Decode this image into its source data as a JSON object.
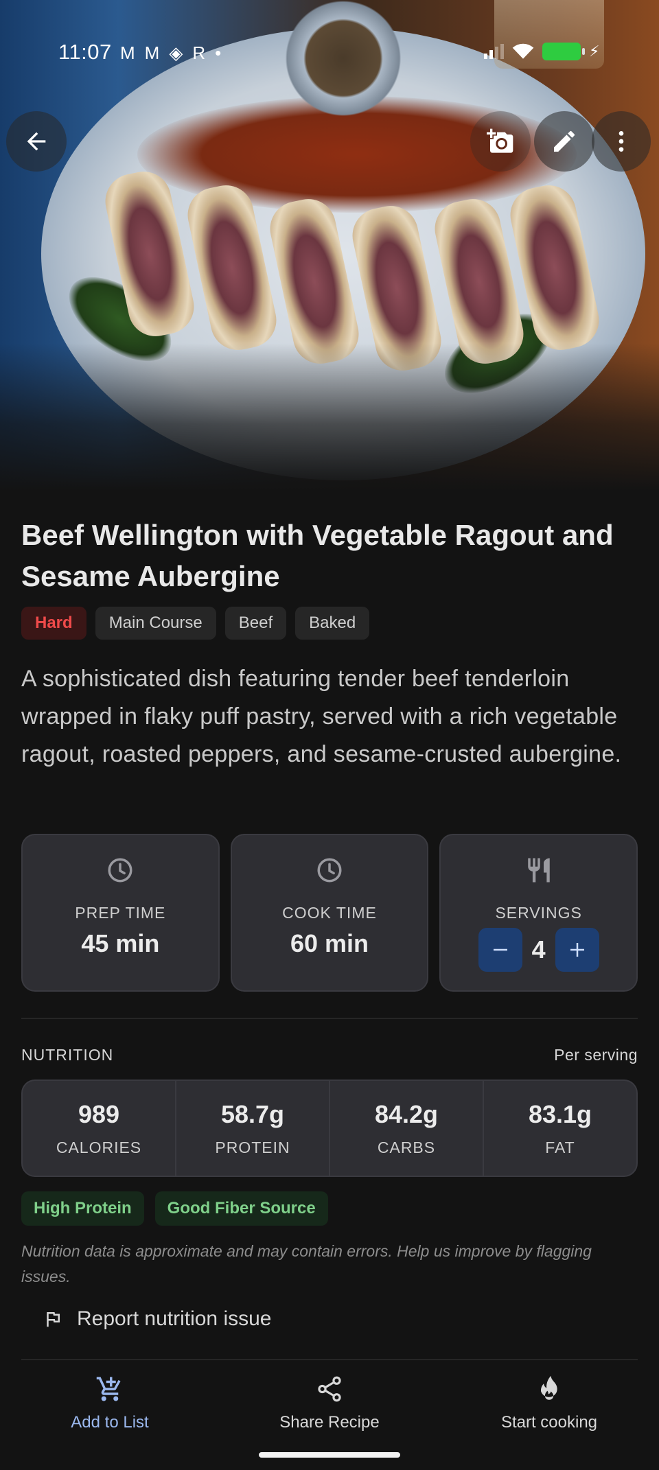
{
  "status_bar": {
    "time": "11:07",
    "notification_icons": [
      "gmail-icon",
      "gmail-icon",
      "app-icon",
      "r-icon",
      "dot-icon"
    ]
  },
  "top_actions": {
    "back": "back-arrow-icon",
    "add_photo": "add-photo-icon",
    "edit": "edit-pencil-icon",
    "more": "more-vert-icon"
  },
  "recipe": {
    "title": "Beef Wellington with Vegetable Ragout and Sesame Aubergine",
    "tags": [
      {
        "label": "Hard"
      },
      {
        "label": "Main Course"
      },
      {
        "label": "Beef"
      },
      {
        "label": "Baked"
      }
    ],
    "description": "A sophisticated dish featuring tender beef tenderloin wrapped in flaky puff pastry, served with a rich vegetable ragout, roasted peppers, and sesame-crusted aubergine."
  },
  "stats": {
    "prep": {
      "label": "PREP TIME",
      "value": "45 min"
    },
    "cook": {
      "label": "COOK TIME",
      "value": "60 min"
    },
    "servings": {
      "label": "SERVINGS",
      "value": "4"
    }
  },
  "nutrition": {
    "heading": "NUTRITION",
    "per": "Per serving",
    "items": [
      {
        "value": "989",
        "label": "CALORIES"
      },
      {
        "value": "58.7g",
        "label": "PROTEIN"
      },
      {
        "value": "84.2g",
        "label": "CARBS"
      },
      {
        "value": "83.1g",
        "label": "FAT"
      }
    ],
    "badges": [
      {
        "label": "High Protein"
      },
      {
        "label": "Good Fiber Source"
      }
    ],
    "disclaimer": "Nutrition data is approximate and may contain errors. Help us improve by flagging issues.",
    "report_label": "Report nutrition issue"
  },
  "bottom_nav": {
    "items": [
      {
        "label": "Add to List",
        "icon": "cart-icon"
      },
      {
        "label": "Share Recipe",
        "icon": "share-icon"
      },
      {
        "label": "Start cooking",
        "icon": "flame-icon"
      }
    ]
  },
  "colors": {
    "background": "#131313",
    "card": "#2e2e33",
    "accent_blue": "#9bb8ee",
    "stepper": "#1d3e72",
    "hard_red": "#ef4a4a",
    "badge_green": "#7fd08a"
  }
}
